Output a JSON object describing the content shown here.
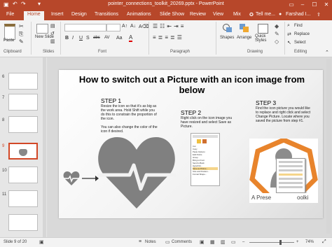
{
  "window": {
    "title": "pointer_connections_toolkit_20269.pptx - PowerPoint",
    "user": "Farshad I..."
  },
  "ribbon": {
    "tabs": [
      "File",
      "Home",
      "Insert",
      "Design",
      "Transitions",
      "Animations",
      "Slide Show",
      "Review",
      "View",
      "Mix"
    ],
    "tell_me": "Tell me...",
    "clipboard": {
      "paste": "Paste",
      "label": "Clipboard"
    },
    "slides": {
      "new_slide": "New Slide",
      "label": "Slides"
    },
    "font": {
      "label": "Font",
      "bold": "B",
      "italic": "I",
      "underline": "U",
      "strike": "S",
      "shadow": "abc",
      "spacing": "AV",
      "case": "Aa",
      "color": "A"
    },
    "paragraph": {
      "label": "Paragraph"
    },
    "drawing": {
      "shapes": "Shapes",
      "arrange": "Arrange",
      "quick_styles": "Quick Styles",
      "label": "Drawing"
    },
    "editing": {
      "find": "Find",
      "replace": "Replace",
      "select": "Select",
      "label": "Editing"
    }
  },
  "slide_panel": {
    "numbers": [
      "6",
      "7",
      "8",
      "9",
      "10",
      "11"
    ],
    "selected": "9"
  },
  "slide": {
    "title": "How to switch out a Picture with an icon image from below",
    "step1": {
      "heading": "STEP 1",
      "text": "Resize the icon so that it's as big as the work area. Hold Shift while you do this to constrain the proportion of the icon.\n\nYou can also change the color of the icon if desired."
    },
    "step2": {
      "heading": "STEP 2",
      "text": "Right click on the icon image you have resized and select Save as Picture."
    },
    "step3": {
      "heading": "STEP 3",
      "text": "Find the icon picture you would like to replace and right click and select Change Picture. Locate where you saved the picture from step #1."
    },
    "caption": "A Prese",
    "caption2": "oolki",
    "context_menu_items": [
      "Cut",
      "Copy",
      "Paste Options:",
      "",
      "Edit Points",
      "Group",
      "Bring to Front",
      "Send to Back",
      "Hyperlink...",
      "Save as Picture...",
      "Size and Position...",
      "Format Shape..."
    ]
  },
  "status": {
    "slide": "Slide 9 of 20",
    "notes": "Notes",
    "comments": "Comments",
    "zoom": "74%"
  },
  "colors": {
    "accent": "#b7472a",
    "icon": "#808080"
  }
}
